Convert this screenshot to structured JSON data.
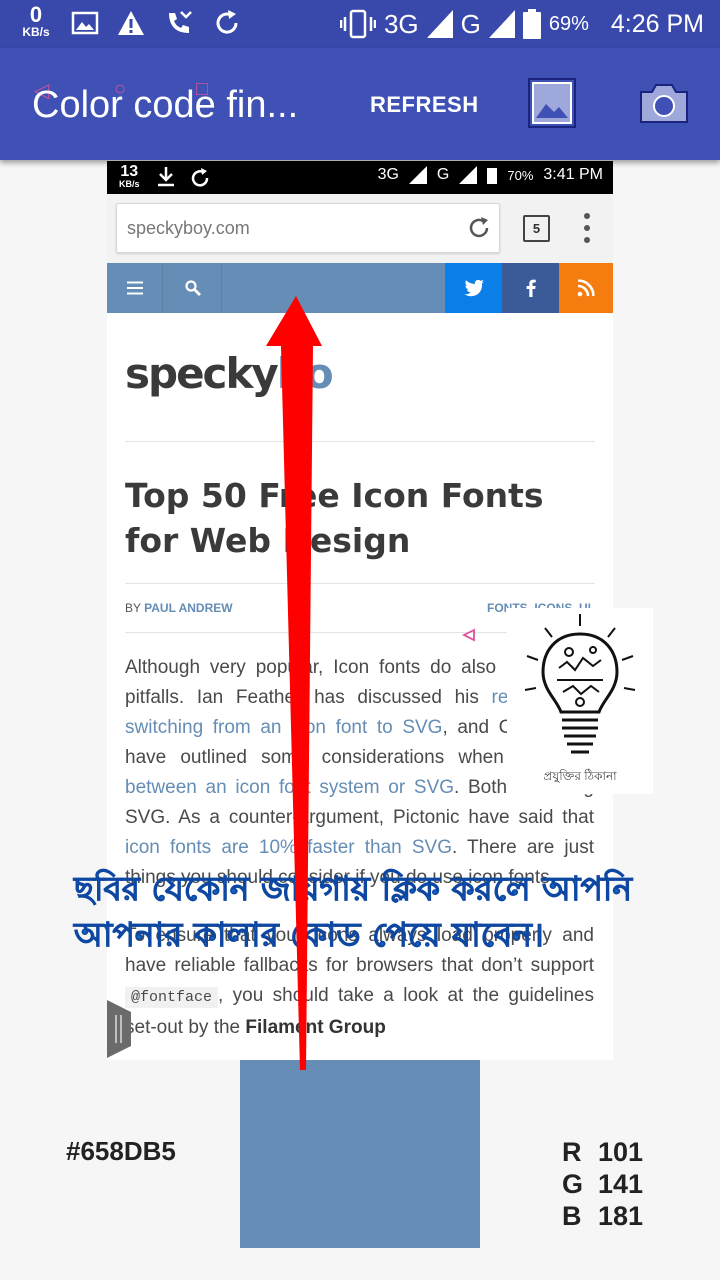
{
  "status_bar": {
    "net_speed": "0",
    "net_unit": "KB/s",
    "signal_3g": "3G",
    "signal_g": "G",
    "battery": "69%",
    "time": "4:26 PM"
  },
  "toolbar": {
    "title": "Color code fin...",
    "refresh_label": "REFRESH",
    "gallery_icon": "image-icon",
    "camera_icon": "camera-icon"
  },
  "embedded_screenshot": {
    "status": {
      "net_speed": "13",
      "net_unit": "KB/s",
      "signal": "3G",
      "signal_g": "G",
      "battery": "70%",
      "time": "3:41 PM"
    },
    "browser": {
      "url": "speckyboy.com",
      "tab_count": "5"
    },
    "site": {
      "logo_dark": "specky",
      "logo_blue": "bo",
      "headline": "Top 50 Free Icon Fonts for Web Design",
      "by": "BY",
      "author": "PAUL ANDREW",
      "categories": "FONTS, ICONS, UI",
      "p1_a": "Although very popular, Icon fonts do also have their pitfalls. Ian Feather has discussed his ",
      "p1_link1": "reasons for switching from an icon font to SVG",
      "p1_b": ", and CSS-Tricks have outlined some considerations when ",
      "p1_link2": "choosing between an icon font system or SVG",
      "p1_c": ". Both favouring SVG. As a counter-argument, Pictonic have said that ",
      "p1_link3": "icon fonts are 10% faster than SVG",
      "p1_d": ". There are just things you should consider if you do use icon fonts.",
      "p2_a": "To ensure that your icons always load properly and have reliable fallbacks for browsers that don’t support ",
      "p2_code": "@fontface",
      "p2_b": ", you should take a look at the guidelines set-out by the ",
      "p2_bold": "Filament Group"
    },
    "bulb_caption": "প্রযুক্তির ঠিকানা"
  },
  "overlay_text": "ছবির যেকোন জায়গায় ক্লিক করলে আপনি আপনার কালার কোড পেয়ে যাবেন।",
  "result": {
    "hex": "#658DB5",
    "swatch_color": "#658db5",
    "r_label": "R",
    "r": "101",
    "g_label": "G",
    "g": "141",
    "b_label": "B",
    "b": "181"
  },
  "colors": {
    "status_bar": "#3949ab",
    "toolbar": "#3f51b5",
    "arrow": "#ff0000",
    "overlay_text": "#1565c0"
  }
}
